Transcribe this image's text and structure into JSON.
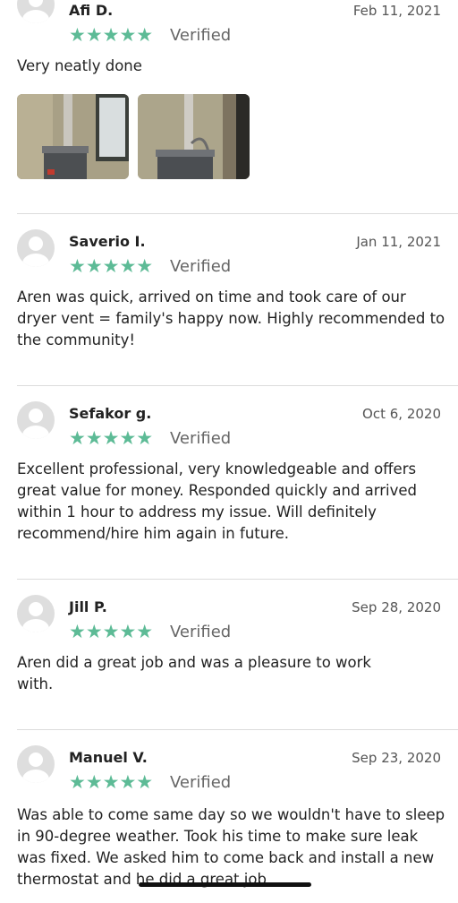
{
  "colors": {
    "star": "#5dbb96",
    "avatar": "#dedede",
    "divider": "#dcdcdc"
  },
  "reviews": [
    {
      "name": "Afi D.",
      "date": "Feb 11, 2021",
      "stars": "★★★★★",
      "verified": "Verified",
      "text": "Very neatly done",
      "photos": [
        "water-heater-photo-1",
        "water-heater-photo-2"
      ]
    },
    {
      "name": "Saverio I.",
      "date": "Jan 11, 2021",
      "stars": "★★★★★",
      "verified": "Verified",
      "text": "Aren was quick, arrived on time and took care of our dryer vent = family's happy now. Highly recommended to the community!"
    },
    {
      "name": "Sefakor g.",
      "date": "Oct 6, 2020",
      "stars": "★★★★★",
      "verified": "Verified",
      "text": "Excellent professional, very knowledgeable and offers great value for money. Responded quickly and arrived within 1 hour to address my issue. Will definitely recommend/hire him again in future."
    },
    {
      "name": "Jill P.",
      "date": "Sep 28, 2020",
      "stars": "★★★★★",
      "verified": "Verified",
      "text": "Aren did a great job and was a pleasure to work with."
    },
    {
      "name": "Manuel V.",
      "date": "Sep 23, 2020",
      "stars": "★★★★★",
      "verified": "Verified",
      "text": "Was able to come same day so we wouldn't have to sleep in 90-degree weather.  Took his time to make sure leak was fixed.  We asked him to come back and install a new thermostat and he did a great job"
    }
  ]
}
